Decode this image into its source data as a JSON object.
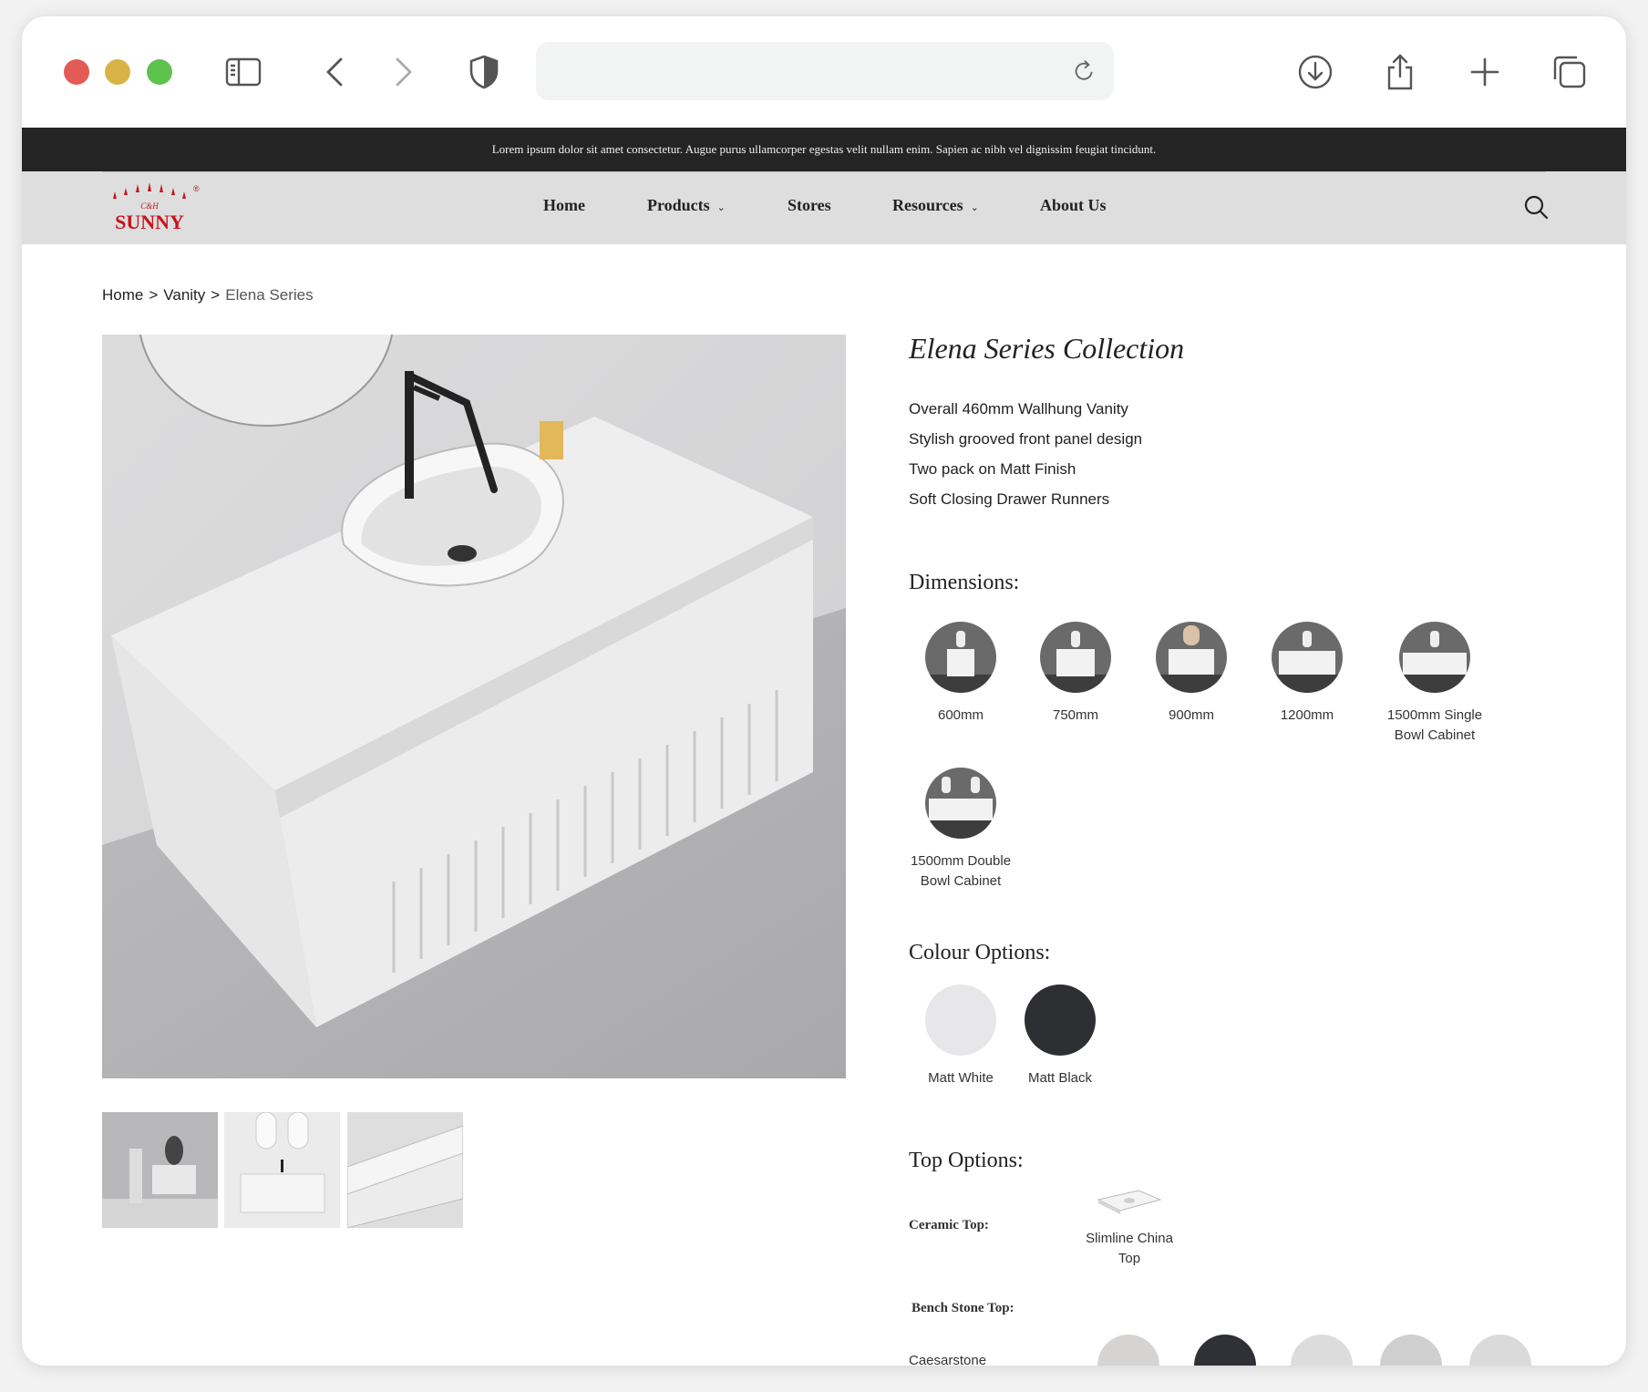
{
  "announcement": "Lorem ipsum dolor sit amet consectetur. Augue purus ullamcorper egestas velit nullam enim. Sapien ac nibh vel dignissim feugiat tincidunt.",
  "brand": {
    "top": "C&H",
    "name": "SUNNY",
    "mark": "®"
  },
  "nav": {
    "items": [
      {
        "label": "Home",
        "has_dropdown": false
      },
      {
        "label": "Products",
        "has_dropdown": true
      },
      {
        "label": "Stores",
        "has_dropdown": false
      },
      {
        "label": "Resources",
        "has_dropdown": true
      },
      {
        "label": "About Us",
        "has_dropdown": false
      }
    ],
    "chevron": "⌄"
  },
  "breadcrumb": {
    "items": [
      "Home",
      "Vanity",
      "Elena Series"
    ],
    "separator": ">"
  },
  "product": {
    "title": "Elena Series Collection",
    "features": [
      "Overall 460mm Wallhung Vanity",
      "Stylish grooved front panel design",
      "Two pack on Matt Finish",
      "Soft Closing Drawer Runners"
    ]
  },
  "dimensions": {
    "heading": "Dimensions:",
    "options": [
      {
        "line1": "600mm",
        "line2": ""
      },
      {
        "line1": "750mm",
        "line2": ""
      },
      {
        "line1": "900mm",
        "line2": ""
      },
      {
        "line1": "1200mm",
        "line2": ""
      },
      {
        "line1": "1500mm Single",
        "line2": "Bowl Cabinet"
      },
      {
        "line1": "1500mm Double",
        "line2": "Bowl Cabinet"
      }
    ]
  },
  "colours": {
    "heading": "Colour Options:",
    "options": [
      {
        "label": "Matt White",
        "color": "#e7e7e9"
      },
      {
        "label": "Matt Black",
        "color": "#2e2f33"
      }
    ]
  },
  "tops": {
    "heading": "Top Options:",
    "ceramic_label": "Ceramic Top:",
    "ceramic_option": {
      "line1": "Slimline China",
      "line2": "Top"
    },
    "bench_label": "Bench Stone Top:",
    "stone_brand": "Caesarstone",
    "stone_colors": [
      "#d6d4d2",
      "#2f3136",
      "#dcdcdc",
      "#cfcfcf",
      "#dadada"
    ]
  },
  "colors": {
    "announce_bg": "#242424",
    "nav_bg": "#dedede",
    "brand_red": "#c8141c"
  }
}
